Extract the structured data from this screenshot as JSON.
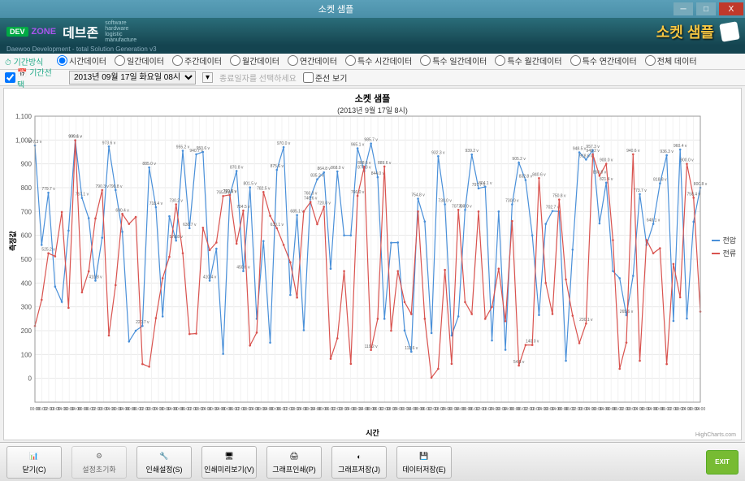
{
  "window": {
    "title": "소켓 샘플",
    "min": "─",
    "max": "□",
    "close": "X"
  },
  "brand": {
    "dev": "DEV",
    "zone": "ZONE",
    "kr": "데브존",
    "sub1": "software",
    "sub2": "hardware",
    "sub3": "logistic",
    "sub4": "manufacture",
    "tagline": "Daewoo Development - total Solution Generation v3",
    "rightlabel": "소켓 샘플"
  },
  "period_group": {
    "label": "⏱ 기간방식",
    "options": [
      "시간데이터",
      "일간데이터",
      "주간데이터",
      "월간데이터",
      "연간데이터",
      "특수 시간데이터",
      "특수 일간데이터",
      "특수 월간데이터",
      "특수 연간데이터",
      "전체 데이터"
    ],
    "selected": 0
  },
  "select_group": {
    "label": "📅 기간선택",
    "dropdown": "2013년 09월 17일 화요일 08시",
    "disabled_text": "종료일자를 선택하세요",
    "checkbox": "준선 보기"
  },
  "chart": {
    "title": "소켓 샘플",
    "subtitle": "(2013년 9월 17일 8시)",
    "ylabel": "측정값",
    "xlabel": "시간",
    "credit": "HighCharts.com",
    "legend": [
      {
        "name": "전압",
        "color": "#4a90d9"
      },
      {
        "name": "전류",
        "color": "#d9534f"
      }
    ]
  },
  "buttons": {
    "close": "닫기(C)",
    "init": "설정초기화",
    "print_set": "인쇄설정(S)",
    "preview": "인쇄미리보기(V)",
    "gprint": "그래프인쇄(P)",
    "gsave": "그래프저장(J)",
    "dsave": "데이터저장(E)",
    "exit": "EXIT",
    "exit_label": "닫기(C)"
  },
  "chart_data": {
    "type": "line",
    "ylim": [
      -100,
      1100
    ],
    "yticks": [
      0,
      100,
      200,
      300,
      400,
      500,
      600,
      700,
      800,
      900,
      1000,
      1100
    ],
    "x_tick_pattern": [
      "00:00",
      "06:00",
      "12:00",
      "18:00",
      "24:00",
      "30:00",
      "34:00"
    ],
    "series": [
      {
        "name": "전압",
        "color": "#4a90d9",
        "values": [
          977,
          560,
          779,
          385,
          321,
          620,
          999,
          757,
          672,
          410,
          590,
          973,
          790,
          615,
          155,
          200,
          220,
          885,
          718,
          260,
          680,
          578,
          955,
          630,
          940,
          950,
          410,
          544,
          103,
          768,
          870,
          450,
          801,
          250,
          576,
          150,
          875,
          970,
          350,
          685,
          202,
          760,
          835,
          864,
          460,
          868,
          600,
          600,
          965,
          870,
          985,
          844,
          250,
          569,
          570,
          201,
          112,
          754,
          658,
          190,
          932,
          730,
          180,
          260,
          707,
          939,
          797,
          804,
          159,
          700,
          120,
          730,
          905,
          832,
          600,
          266,
          648,
          702,
          700,
          74,
          540,
          948,
          918,
          957,
          650,
          821,
          450,
          420,
          265,
          430,
          773,
          560,
          648,
          818,
          936,
          241,
          960,
          251,
          657,
          800
        ]
      },
      {
        "name": "전류",
        "color": "#d9534f",
        "values": [
          220,
          330,
          525,
          512,
          698,
          296,
          999,
          361,
          449,
          671,
          790,
          180,
          391,
          690,
          648,
          677,
          60,
          49,
          253,
          420,
          510,
          730,
          525,
          186,
          188,
          632,
          538,
          570,
          765,
          770,
          565,
          704,
          138,
          192,
          782,
          682,
          630,
          560,
          487,
          339,
          700,
          740,
          647,
          720,
          82,
          168,
          450,
          61,
          766,
          888,
          119,
          250,
          889,
          200,
          450,
          320,
          270,
          700,
          250,
          3,
          40,
          455,
          61,
          707,
          320,
          270,
          700,
          250,
          300,
          460,
          240,
          660,
          54,
          140,
          140,
          840,
          400,
          270,
          750,
          415,
          263,
          148,
          230,
          940,
          850,
          900,
          580,
          40,
          150,
          940,
          74,
          580,
          525,
          546,
          60,
          480,
          340,
          900,
          758,
          280
        ]
      }
    ]
  }
}
